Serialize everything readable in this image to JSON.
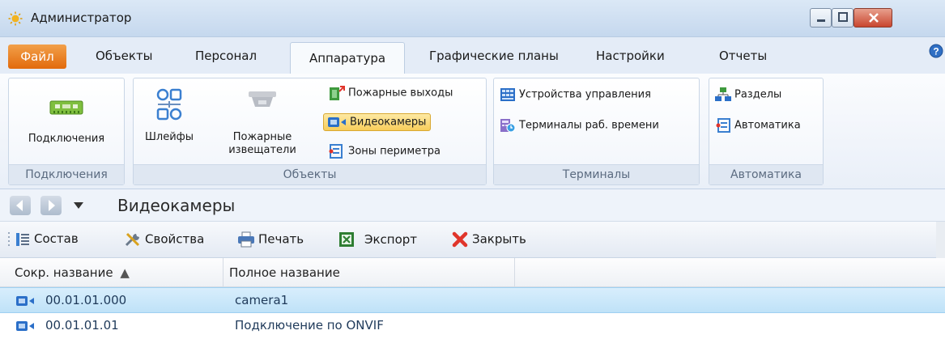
{
  "window": {
    "title": "Администратор",
    "app_icon": "app-sun-icon"
  },
  "tabs": {
    "file": "Файл",
    "items": [
      "Объекты",
      "Персонал",
      "Аппаратура",
      "Графические планы",
      "Настройки",
      "Отчеты"
    ],
    "active": "Аппаратура"
  },
  "ribbon": {
    "groups": [
      {
        "label": "Подключения",
        "buttons": [
          {
            "label": "Подключения",
            "icon": "connection-board-icon"
          }
        ]
      },
      {
        "label": "Объекты",
        "buttons": [
          {
            "label": "Шлейфы",
            "icon": "loops-icon"
          },
          {
            "label": "Пожарные извещатели",
            "line1": "Пожарные",
            "line2": "извещатели",
            "icon": "smoke-detector-icon"
          },
          {
            "label": "Пожарные выходы",
            "icon": "fire-exit-icon"
          },
          {
            "label": "Видеокамеры",
            "icon": "video-camera-icon",
            "active": true
          },
          {
            "label": "Зоны периметра",
            "icon": "perimeter-zones-icon"
          }
        ]
      },
      {
        "label": "Терминалы",
        "buttons": [
          {
            "label": "Устройства управления",
            "icon": "control-devices-icon"
          },
          {
            "label": "Терминалы раб. времени",
            "icon": "time-terminal-icon"
          }
        ]
      },
      {
        "label": "Автоматика",
        "buttons": [
          {
            "label": "Разделы",
            "icon": "partitions-icon"
          },
          {
            "label": "Автоматика",
            "icon": "automation-icon"
          }
        ]
      }
    ]
  },
  "nav": {
    "title": "Видеокамеры"
  },
  "toolbar": {
    "composition": "Состав",
    "properties": "Свойства",
    "print": "Печать",
    "export": "Экспорт",
    "close": "Закрыть"
  },
  "grid": {
    "columns": [
      "Сокр. название",
      "Полное название"
    ],
    "sort_indicator": "▲",
    "rows": [
      {
        "short": "00.01.01.000",
        "full": "camera1",
        "selected": true
      },
      {
        "short": "00.01.01.01",
        "full": "Подключение по ONVIF",
        "selected": false
      }
    ]
  },
  "colors": {
    "accent_orange": "#e26a0c",
    "selection": "#bfe2f8",
    "close_red": "#c9462f"
  }
}
